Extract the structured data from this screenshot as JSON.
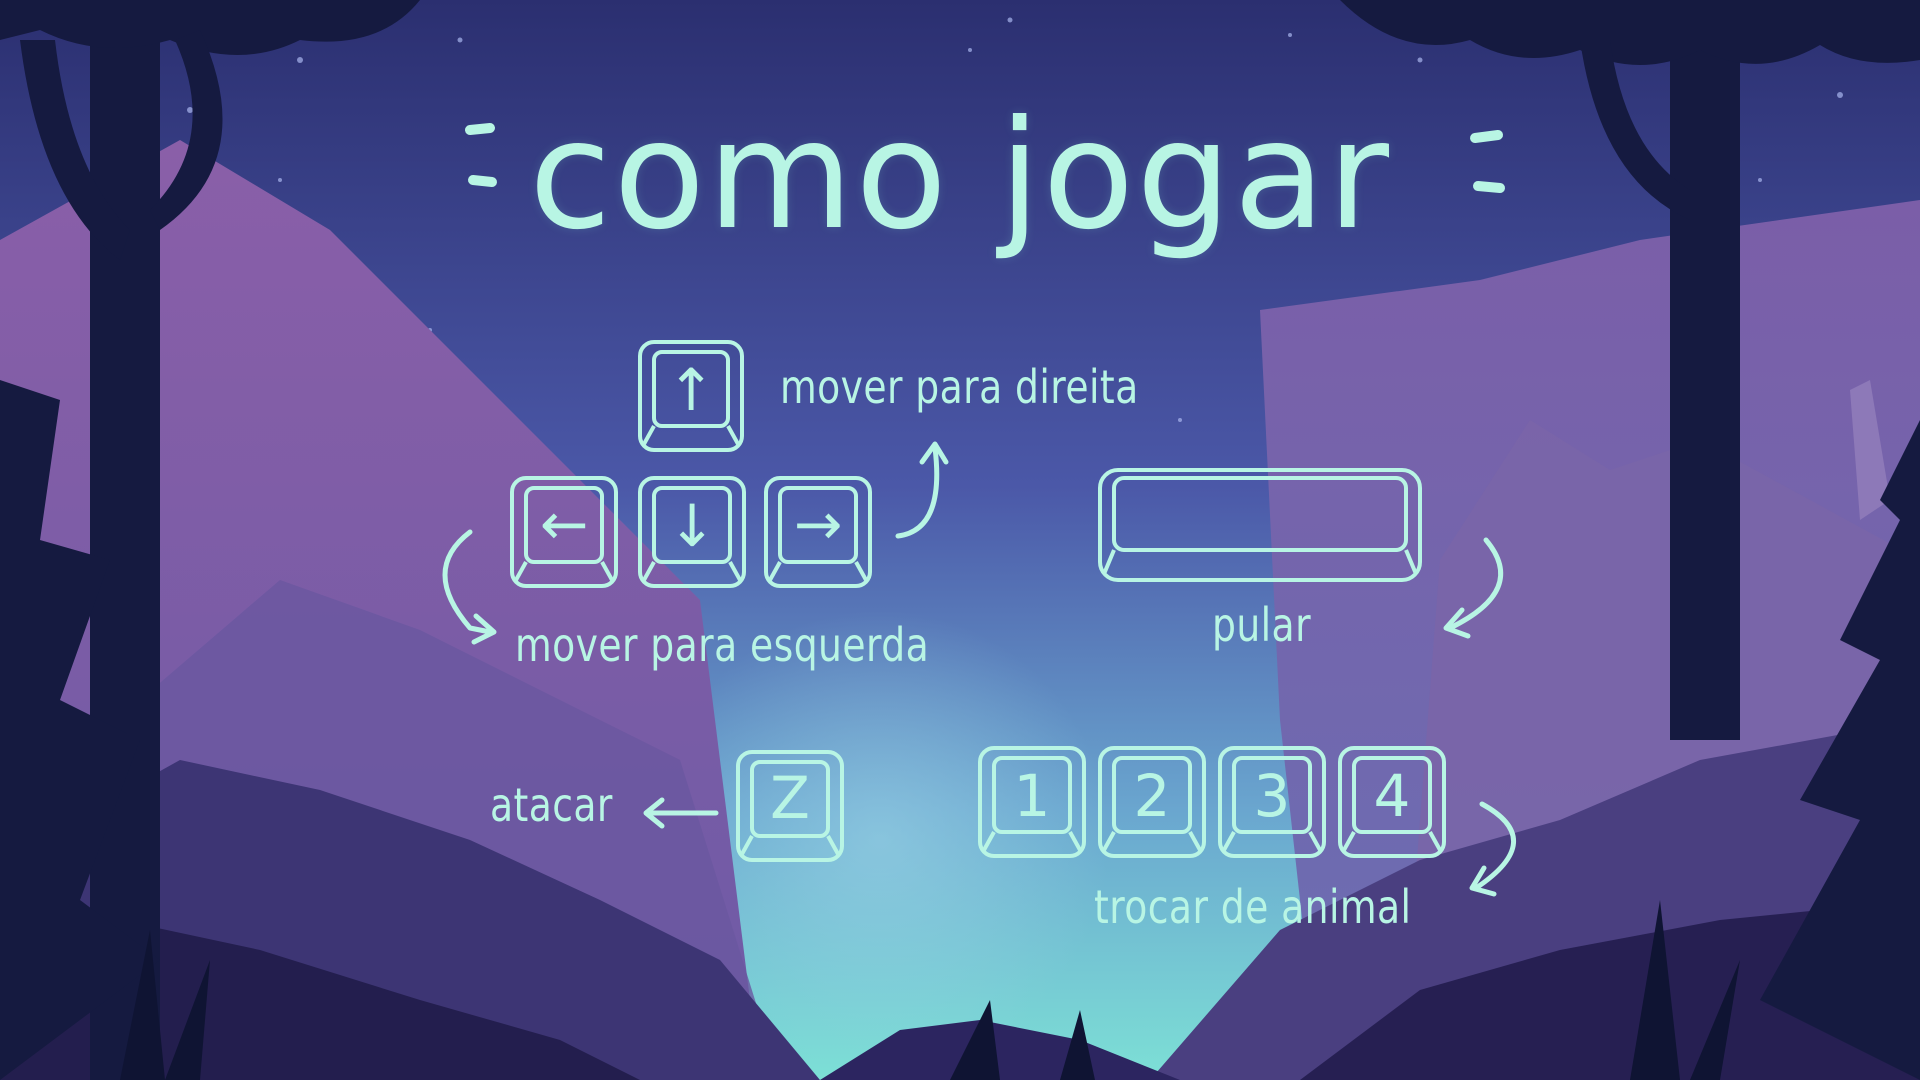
{
  "title": "como jogar",
  "controls": {
    "move_right": "mover para direita",
    "move_left": "mover para esquerda",
    "jump": "pular",
    "attack": "atacar",
    "switch_animal": "trocar de animal"
  },
  "keys": {
    "up": "↑",
    "left": "←",
    "down": "↓",
    "right": "→",
    "attack": "Z",
    "animals": [
      "1",
      "2",
      "3",
      "4"
    ]
  },
  "colors": {
    "accent": "#b8f5e4",
    "sky_top": "#2b2f70",
    "sky_bottom": "#5fc0d0",
    "mountain": "#9b6fae",
    "tree": "#141a3e"
  }
}
